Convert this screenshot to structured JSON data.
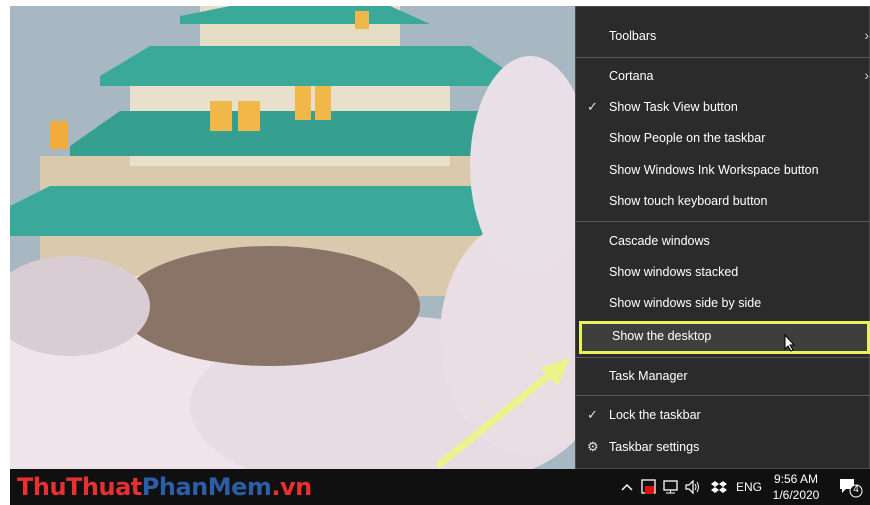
{
  "menu": {
    "items": [
      {
        "label": "Toolbars",
        "check": "",
        "arrow": "›"
      },
      {
        "label": "Cortana",
        "check": "",
        "arrow": "›"
      },
      {
        "label": "Show Task View button",
        "check": "✓",
        "arrow": ""
      },
      {
        "label": "Show People on the taskbar",
        "check": "",
        "arrow": ""
      },
      {
        "label": "Show Windows Ink Workspace button",
        "check": "",
        "arrow": ""
      },
      {
        "label": "Show touch keyboard button",
        "check": "",
        "arrow": ""
      },
      {
        "label": "Cascade windows",
        "check": "",
        "arrow": ""
      },
      {
        "label": "Show windows stacked",
        "check": "",
        "arrow": ""
      },
      {
        "label": "Show windows side by side",
        "check": "",
        "arrow": ""
      },
      {
        "label": "Show the desktop",
        "check": "",
        "arrow": ""
      },
      {
        "label": "Task Manager",
        "check": "",
        "arrow": ""
      },
      {
        "label": "Lock the taskbar",
        "check": "✓",
        "arrow": ""
      },
      {
        "label": "Taskbar settings",
        "check": "⚙",
        "arrow": ""
      }
    ]
  },
  "taskbar": {
    "watermark": {
      "part1": "ThuThuat",
      "part2": "PhanMem",
      "part3": ".vn"
    },
    "language": "ENG",
    "time": "9:56 AM",
    "date": "1/6/2020",
    "notification_count": "4",
    "tray_icons": [
      "chevron-up-icon",
      "app-icon",
      "network-icon",
      "volume-icon",
      "dropbox-icon"
    ]
  },
  "colors": {
    "menu_bg": "#2b2b2b",
    "highlight_border": "#e9f25a",
    "taskbar_bg": "#101010"
  }
}
